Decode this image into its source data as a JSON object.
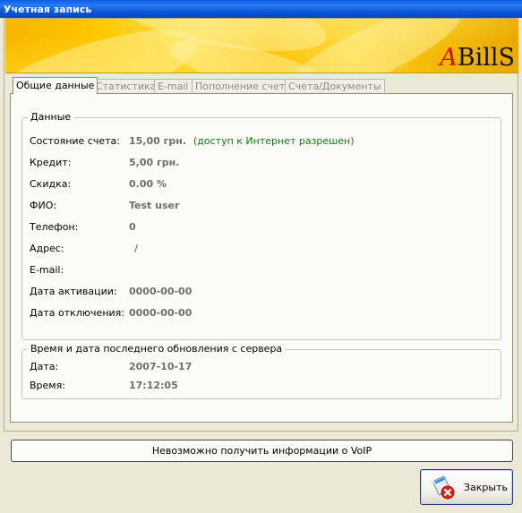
{
  "window": {
    "title": "Учетная запись"
  },
  "logo": {
    "prefix": "A",
    "text": "BillS"
  },
  "tabs": [
    {
      "label": "Общие данные",
      "active": true
    },
    {
      "label": "Статистика",
      "active": false
    },
    {
      "label": "E-mail",
      "active": false
    },
    {
      "label": "Пополнение счета",
      "active": false
    },
    {
      "label": "Счета/Документы",
      "active": false
    }
  ],
  "account": {
    "legend": "Данные",
    "rows": [
      {
        "label": "Состояние счета:",
        "value": "15,00 грн.",
        "note": "(доступ к Интернет разрешен)"
      },
      {
        "label": "Кредит:",
        "value": "5,00 грн."
      },
      {
        "label": "Скидка:",
        "value": "0.00 %"
      },
      {
        "label": "ФИО:",
        "value": "Test user"
      },
      {
        "label": "Телефон:",
        "value": "0"
      },
      {
        "label": "Адрес:",
        "value": "/"
      },
      {
        "label": "E-mail:",
        "value": ""
      },
      {
        "label": "Дата активации:",
        "value": "0000-00-00"
      },
      {
        "label": "Дата отключения:",
        "value": "0000-00-00"
      }
    ]
  },
  "update": {
    "legend": "Время и дата последнего обновления с сервера",
    "rows": [
      {
        "label": "Дата:",
        "value": "2007-10-17"
      },
      {
        "label": "Время:",
        "value": "17:12:05"
      }
    ]
  },
  "voip": {
    "message": "Невозможно получить информации о VoIP"
  },
  "buttons": {
    "close_label": "Закрыть"
  },
  "colors": {
    "titlebar": "#0a53d8",
    "note": "#117a11",
    "banner": "#ffc800",
    "logo_accent": "#d0121b"
  }
}
